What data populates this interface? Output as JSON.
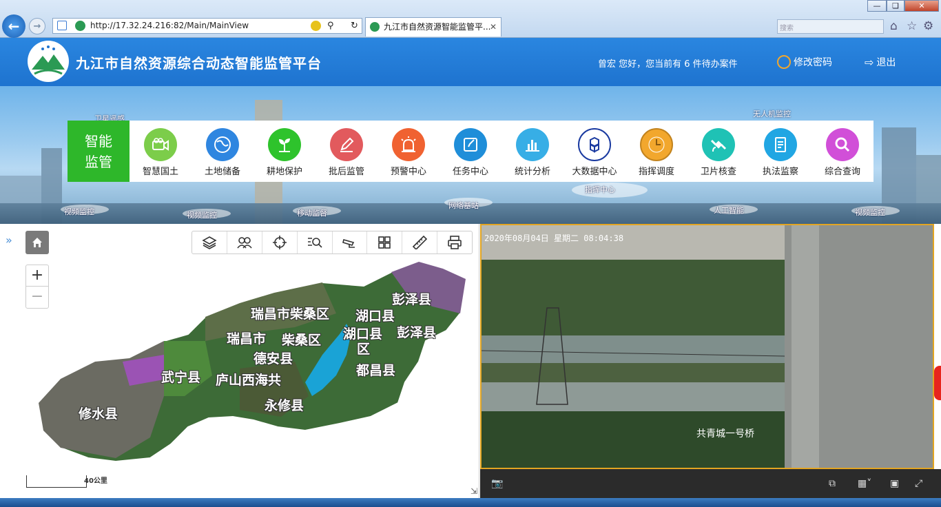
{
  "browser": {
    "url": "http://17.32.24.216:82/Main/MainView",
    "tab_title": "九江市自然资源智能监管平...",
    "search_placeholder": "搜索"
  },
  "header": {
    "title": "九江市自然资源综合动态智能监管平台",
    "greeting": "曾宏 您好，您当前有 6 件待办案件",
    "change_password": "修改密码",
    "logout": "退出"
  },
  "banner": {
    "labels": {
      "satellite": "卫星遥感",
      "drone": "无人机监控",
      "video1": "视频监控",
      "video2": "视频监控",
      "mobile": "移动监督",
      "network": "网络基站",
      "command": "指挥中心",
      "ai": "人工智能",
      "video3": "视频监控"
    }
  },
  "menu": {
    "lead": "智能监管",
    "items": [
      {
        "label": "智慧国土",
        "color": "#7ccd4a",
        "icon": "camera-icon"
      },
      {
        "label": "土地储备",
        "color": "#2f86e0",
        "icon": "globe-icon"
      },
      {
        "label": "耕地保护",
        "color": "#2ec32c",
        "icon": "sprout-icon"
      },
      {
        "label": "批后监管",
        "color": "#e25a5d",
        "icon": "edit-icon"
      },
      {
        "label": "预警中心",
        "color": "#f06231",
        "icon": "alarm-icon"
      },
      {
        "label": "任务中心",
        "color": "#1f8ed9",
        "icon": "task-icon"
      },
      {
        "label": "统计分析",
        "color": "#37aee6",
        "icon": "bar-chart-icon"
      },
      {
        "label": "大数据中心",
        "color": "#1a3aa0",
        "icon": "cubes-icon"
      },
      {
        "label": "指挥调度",
        "color": "#f2a72d",
        "icon": "clock-icon"
      },
      {
        "label": "卫片核查",
        "color": "#1fc2b5",
        "icon": "satellite-icon"
      },
      {
        "label": "执法监察",
        "color": "#21a6e3",
        "icon": "document-icon"
      },
      {
        "label": "综合查询",
        "color": "#d14fd8",
        "icon": "search-icon"
      }
    ]
  },
  "map": {
    "scale_label": "40公里",
    "places": [
      {
        "name": "彭泽县"
      },
      {
        "name": "瑞昌市柴桑区"
      },
      {
        "name": "湖口县"
      },
      {
        "name": "瑞昌市"
      },
      {
        "name": "柴桑区"
      },
      {
        "name": "湖口县"
      },
      {
        "name": "彭泽县"
      },
      {
        "name": "德安县"
      },
      {
        "name": "区"
      },
      {
        "name": "都昌县"
      },
      {
        "name": "武宁县"
      },
      {
        "name": "庐山西海共"
      },
      {
        "name": "永修县"
      },
      {
        "name": "修水县"
      }
    ]
  },
  "video": {
    "timestamp": "2020年08月04日  星期二  08:04:38",
    "caption": "共青城一号桥"
  }
}
